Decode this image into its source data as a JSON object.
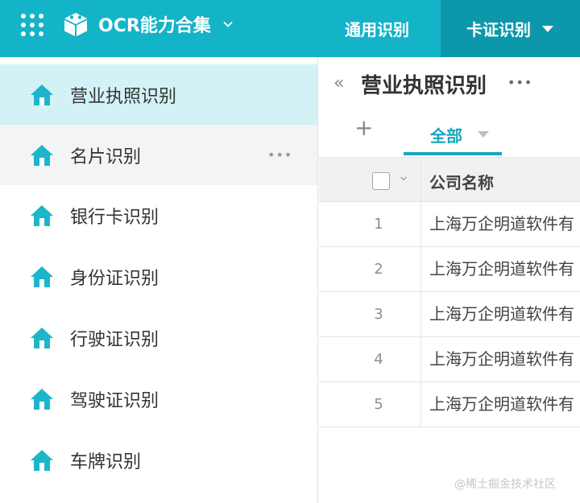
{
  "topbar": {
    "brand_title": "OCR能力合集",
    "tabs": [
      {
        "label": "通用识别"
      },
      {
        "label": "卡证识别"
      }
    ]
  },
  "sidebar": {
    "items": [
      {
        "label": "营业执照识别",
        "state": "active"
      },
      {
        "label": "名片识别",
        "state": "hover",
        "more": "•••"
      },
      {
        "label": "银行卡识别"
      },
      {
        "label": "身份证识别"
      },
      {
        "label": "行驶证识别"
      },
      {
        "label": "驾驶证识别"
      },
      {
        "label": "车牌识别"
      }
    ]
  },
  "main": {
    "collapse": "«",
    "title": "营业执照识别",
    "title_more": "•••",
    "add": "+",
    "view_tab": {
      "label": "全部"
    },
    "table": {
      "column": "公司名称",
      "rows": [
        {
          "index": "1",
          "company": "上海万企明道软件有"
        },
        {
          "index": "2",
          "company": "上海万企明道软件有"
        },
        {
          "index": "3",
          "company": "上海万企明道软件有"
        },
        {
          "index": "4",
          "company": "上海万企明道软件有"
        },
        {
          "index": "5",
          "company": "上海万企明道软件有"
        }
      ]
    }
  },
  "watermark": "@稀土掘金技术社区",
  "colors": {
    "accent": "#14b4c8",
    "accent_dark": "#0c97aa",
    "active_bg": "#d2f2f5",
    "tab_blue": "#14a8bd"
  },
  "icons": {
    "app_menu": "grid-dots-icon",
    "brand": "cube-icon",
    "menu_item": "home-icon"
  }
}
